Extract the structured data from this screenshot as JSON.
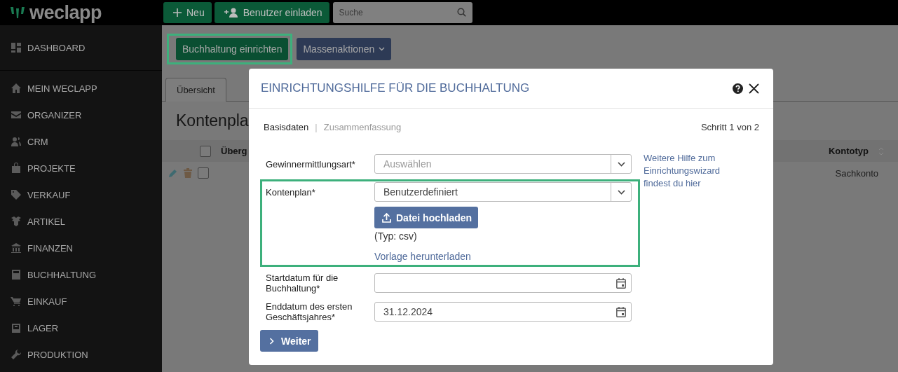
{
  "logo": {
    "text": "weclapp"
  },
  "topbar": {
    "buttons": [
      {
        "label": "Neu"
      },
      {
        "label": "Benutzer einladen"
      }
    ],
    "search": {
      "placeholder": "Suche"
    }
  },
  "sidebar": {
    "items": [
      {
        "label": "DASHBOARD"
      },
      {
        "label": "MEIN WECLAPP"
      },
      {
        "label": "ORGANIZER"
      },
      {
        "label": "CRM"
      },
      {
        "label": "PROJEKTE"
      },
      {
        "label": "VERKAUF"
      },
      {
        "label": "ARTIKEL"
      },
      {
        "label": "FINANZEN"
      },
      {
        "label": "BUCHHALTUNG"
      },
      {
        "label": "EINKAUF"
      },
      {
        "label": "LAGER"
      },
      {
        "label": "PRODUKTION"
      }
    ]
  },
  "toolbar": {
    "buttons": [
      {
        "label": "Buchhaltung einrichten",
        "kind": "primary",
        "highlighted": true
      },
      {
        "label": "Massenaktionen",
        "kind": "dropdown",
        "highlighted": false
      }
    ]
  },
  "tabs": [
    {
      "label": "Übersicht",
      "selected": true
    }
  ],
  "page_title": "Kontenpla",
  "table": {
    "columns": [
      "Überg",
      "Kontotyp"
    ],
    "header_checked": false,
    "rows": [
      {
        "checked": false,
        "cells": [
          "",
          "Sachkonto"
        ]
      }
    ]
  },
  "dialog": {
    "title": "EINRICHTUNGSHILFE FÜR DIE BUCHHALTUNG",
    "steps": [
      {
        "label": "Basisdaten",
        "selected": true
      },
      {
        "label": "Zusammenfassung",
        "selected": false
      }
    ],
    "step_separator": "|",
    "step_counter": "Schritt 1 von 2",
    "help_link": "Weitere Hilfe zum Einrichtungswizard findest du hier",
    "fields": [
      {
        "label": "Gewinnermittlungsart*",
        "kind": "select",
        "placeholder": "Auswählen",
        "highlighted": false
      },
      {
        "label": "Kontenplan*",
        "kind": "select",
        "value": "Benutzerdefiniert",
        "highlighted": true,
        "upload": {
          "button": "Datei hochladen",
          "hint": "(Typ: csv)",
          "link": "Vorlage herunterladen"
        }
      },
      {
        "label": "Startdatum für die Buchhaltung*",
        "kind": "date",
        "highlighted": false
      },
      {
        "label": "Enddatum des ersten Geschäftsjahres*",
        "kind": "date",
        "value": "31.12.2024",
        "highlighted": false
      }
    ],
    "next_button": "Weiter"
  }
}
